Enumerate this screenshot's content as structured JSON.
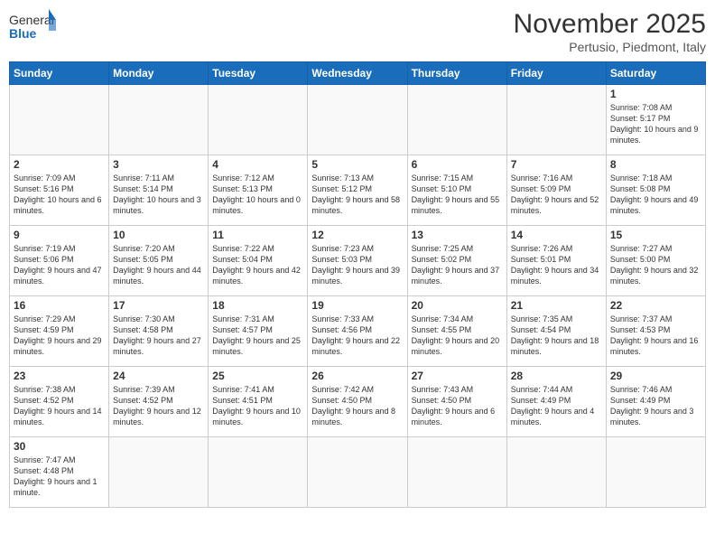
{
  "header": {
    "logo_general": "General",
    "logo_blue": "Blue",
    "month_title": "November 2025",
    "location": "Pertusio, Piedmont, Italy"
  },
  "days_of_week": [
    "Sunday",
    "Monday",
    "Tuesday",
    "Wednesday",
    "Thursday",
    "Friday",
    "Saturday"
  ],
  "weeks": [
    [
      {
        "day": "",
        "info": ""
      },
      {
        "day": "",
        "info": ""
      },
      {
        "day": "",
        "info": ""
      },
      {
        "day": "",
        "info": ""
      },
      {
        "day": "",
        "info": ""
      },
      {
        "day": "",
        "info": ""
      },
      {
        "day": "1",
        "info": "Sunrise: 7:08 AM\nSunset: 5:17 PM\nDaylight: 10 hours and 9 minutes."
      }
    ],
    [
      {
        "day": "2",
        "info": "Sunrise: 7:09 AM\nSunset: 5:16 PM\nDaylight: 10 hours and 6 minutes."
      },
      {
        "day": "3",
        "info": "Sunrise: 7:11 AM\nSunset: 5:14 PM\nDaylight: 10 hours and 3 minutes."
      },
      {
        "day": "4",
        "info": "Sunrise: 7:12 AM\nSunset: 5:13 PM\nDaylight: 10 hours and 0 minutes."
      },
      {
        "day": "5",
        "info": "Sunrise: 7:13 AM\nSunset: 5:12 PM\nDaylight: 9 hours and 58 minutes."
      },
      {
        "day": "6",
        "info": "Sunrise: 7:15 AM\nSunset: 5:10 PM\nDaylight: 9 hours and 55 minutes."
      },
      {
        "day": "7",
        "info": "Sunrise: 7:16 AM\nSunset: 5:09 PM\nDaylight: 9 hours and 52 minutes."
      },
      {
        "day": "8",
        "info": "Sunrise: 7:18 AM\nSunset: 5:08 PM\nDaylight: 9 hours and 49 minutes."
      }
    ],
    [
      {
        "day": "9",
        "info": "Sunrise: 7:19 AM\nSunset: 5:06 PM\nDaylight: 9 hours and 47 minutes."
      },
      {
        "day": "10",
        "info": "Sunrise: 7:20 AM\nSunset: 5:05 PM\nDaylight: 9 hours and 44 minutes."
      },
      {
        "day": "11",
        "info": "Sunrise: 7:22 AM\nSunset: 5:04 PM\nDaylight: 9 hours and 42 minutes."
      },
      {
        "day": "12",
        "info": "Sunrise: 7:23 AM\nSunset: 5:03 PM\nDaylight: 9 hours and 39 minutes."
      },
      {
        "day": "13",
        "info": "Sunrise: 7:25 AM\nSunset: 5:02 PM\nDaylight: 9 hours and 37 minutes."
      },
      {
        "day": "14",
        "info": "Sunrise: 7:26 AM\nSunset: 5:01 PM\nDaylight: 9 hours and 34 minutes."
      },
      {
        "day": "15",
        "info": "Sunrise: 7:27 AM\nSunset: 5:00 PM\nDaylight: 9 hours and 32 minutes."
      }
    ],
    [
      {
        "day": "16",
        "info": "Sunrise: 7:29 AM\nSunset: 4:59 PM\nDaylight: 9 hours and 29 minutes."
      },
      {
        "day": "17",
        "info": "Sunrise: 7:30 AM\nSunset: 4:58 PM\nDaylight: 9 hours and 27 minutes."
      },
      {
        "day": "18",
        "info": "Sunrise: 7:31 AM\nSunset: 4:57 PM\nDaylight: 9 hours and 25 minutes."
      },
      {
        "day": "19",
        "info": "Sunrise: 7:33 AM\nSunset: 4:56 PM\nDaylight: 9 hours and 22 minutes."
      },
      {
        "day": "20",
        "info": "Sunrise: 7:34 AM\nSunset: 4:55 PM\nDaylight: 9 hours and 20 minutes."
      },
      {
        "day": "21",
        "info": "Sunrise: 7:35 AM\nSunset: 4:54 PM\nDaylight: 9 hours and 18 minutes."
      },
      {
        "day": "22",
        "info": "Sunrise: 7:37 AM\nSunset: 4:53 PM\nDaylight: 9 hours and 16 minutes."
      }
    ],
    [
      {
        "day": "23",
        "info": "Sunrise: 7:38 AM\nSunset: 4:52 PM\nDaylight: 9 hours and 14 minutes."
      },
      {
        "day": "24",
        "info": "Sunrise: 7:39 AM\nSunset: 4:52 PM\nDaylight: 9 hours and 12 minutes."
      },
      {
        "day": "25",
        "info": "Sunrise: 7:41 AM\nSunset: 4:51 PM\nDaylight: 9 hours and 10 minutes."
      },
      {
        "day": "26",
        "info": "Sunrise: 7:42 AM\nSunset: 4:50 PM\nDaylight: 9 hours and 8 minutes."
      },
      {
        "day": "27",
        "info": "Sunrise: 7:43 AM\nSunset: 4:50 PM\nDaylight: 9 hours and 6 minutes."
      },
      {
        "day": "28",
        "info": "Sunrise: 7:44 AM\nSunset: 4:49 PM\nDaylight: 9 hours and 4 minutes."
      },
      {
        "day": "29",
        "info": "Sunrise: 7:46 AM\nSunset: 4:49 PM\nDaylight: 9 hours and 3 minutes."
      }
    ],
    [
      {
        "day": "30",
        "info": "Sunrise: 7:47 AM\nSunset: 4:48 PM\nDaylight: 9 hours and 1 minute."
      },
      {
        "day": "",
        "info": ""
      },
      {
        "day": "",
        "info": ""
      },
      {
        "day": "",
        "info": ""
      },
      {
        "day": "",
        "info": ""
      },
      {
        "day": "",
        "info": ""
      },
      {
        "day": "",
        "info": ""
      }
    ]
  ]
}
